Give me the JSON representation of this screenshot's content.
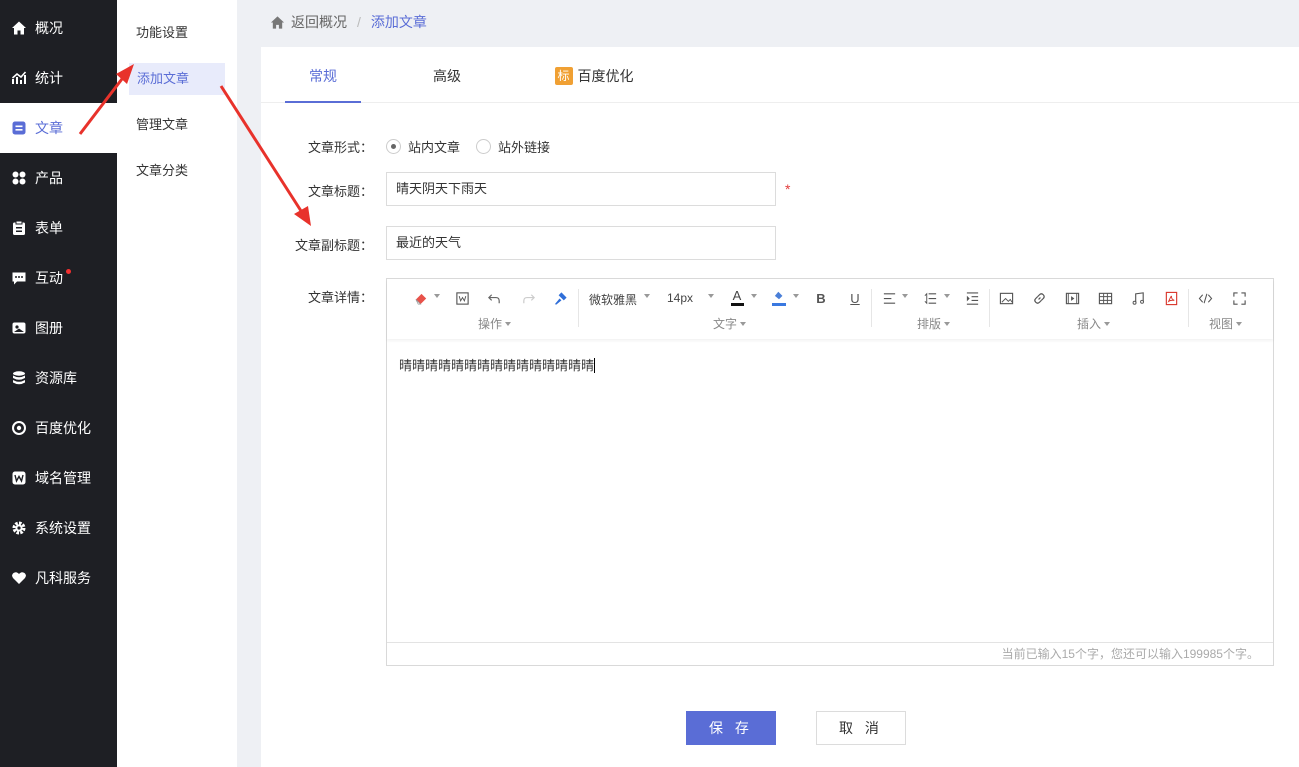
{
  "sidebar": {
    "items": [
      {
        "label": "概况",
        "icon": "home-icon"
      },
      {
        "label": "统计",
        "icon": "chart-icon"
      },
      {
        "label": "文章",
        "icon": "article-icon",
        "active": true
      },
      {
        "label": "产品",
        "icon": "grid-icon"
      },
      {
        "label": "表单",
        "icon": "clipboard-icon"
      },
      {
        "label": "互动",
        "icon": "chat-icon",
        "badge": true
      },
      {
        "label": "图册",
        "icon": "image-icon"
      },
      {
        "label": "资源库",
        "icon": "database-icon"
      },
      {
        "label": "百度优化",
        "icon": "target-icon"
      },
      {
        "label": "域名管理",
        "icon": "domain-icon"
      },
      {
        "label": "系统设置",
        "icon": "gear-icon"
      },
      {
        "label": "凡科服务",
        "icon": "heart-icon"
      }
    ]
  },
  "submenu": {
    "items": [
      {
        "label": "功能设置"
      },
      {
        "label": "添加文章",
        "active": true
      },
      {
        "label": "管理文章"
      },
      {
        "label": "文章分类"
      }
    ]
  },
  "breadcrumb": {
    "back": "返回概况",
    "separator": "/",
    "current": "添加文章"
  },
  "tabs": [
    {
      "label": "常规",
      "active": true
    },
    {
      "label": "高级"
    },
    {
      "label": "百度优化",
      "badge": "标"
    }
  ],
  "form": {
    "type_label": "文章形式：",
    "type_options": [
      "站内文章",
      "站外链接"
    ],
    "type_selected": "站内文章",
    "title_label": "文章标题：",
    "title_value": "晴天阴天下雨天",
    "required_mark": "*",
    "subtitle_label": "文章副标题：",
    "subtitle_value": "最近的天气",
    "detail_label": "文章详情："
  },
  "editor": {
    "font_family": "微软雅黑",
    "font_size": "14px",
    "text_color_glyph": "A",
    "bold_glyph": "B",
    "underline_glyph": "U",
    "groups": [
      "操作",
      "文字",
      "排版",
      "插入",
      "视图"
    ],
    "content": "晴晴晴晴晴晴晴晴晴晴晴晴晴晴晴",
    "status": "当前已输入15个字，您还可以输入199985个字。"
  },
  "buttons": {
    "save": "保 存",
    "cancel": "取 消"
  },
  "colors": {
    "accent": "#5a6dd6",
    "sidebar_bg": "#1e1f24",
    "arrow": "#e8322b"
  }
}
